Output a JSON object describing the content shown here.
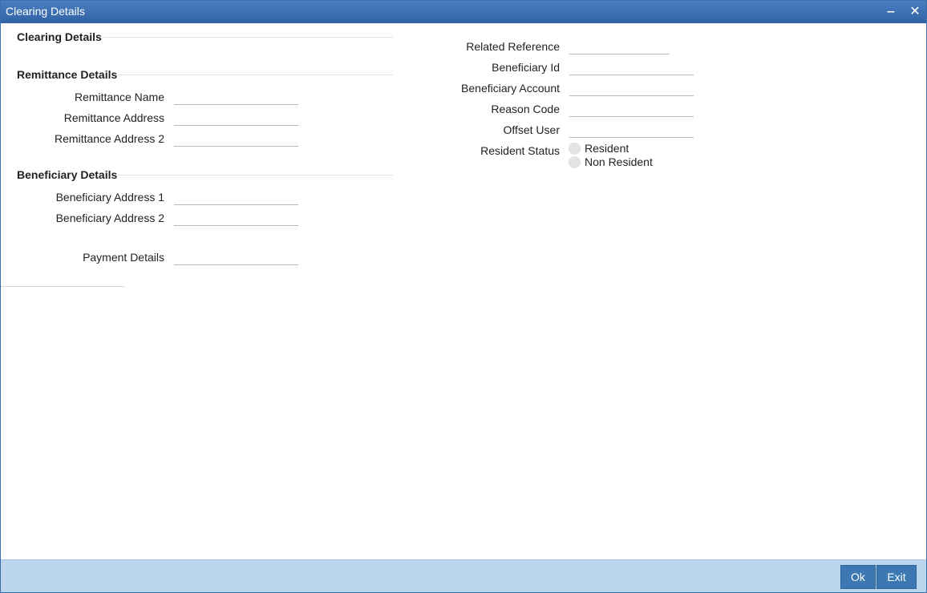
{
  "window": {
    "title": "Clearing Details",
    "minimize_icon": "minimize-icon",
    "close_icon": "close-icon"
  },
  "sections": {
    "clearing": "Clearing Details",
    "remittance": "Remittance Details",
    "beneficiary": "Beneficiary Details"
  },
  "left_fields": {
    "remittance_name": {
      "label": "Remittance Name",
      "value": ""
    },
    "remittance_address": {
      "label": "Remittance Address",
      "value": ""
    },
    "remittance_address_2": {
      "label": "Remittance Address 2",
      "value": ""
    },
    "beneficiary_address_1": {
      "label": "Beneficiary Address 1",
      "value": ""
    },
    "beneficiary_address_2": {
      "label": "Beneficiary Address 2",
      "value": ""
    },
    "payment_details": {
      "label": "Payment Details",
      "value": ""
    }
  },
  "right_fields": {
    "related_reference": {
      "label": "Related Reference",
      "value": ""
    },
    "beneficiary_id": {
      "label": "Beneficiary Id",
      "value": ""
    },
    "beneficiary_account": {
      "label": "Beneficiary Account",
      "value": ""
    },
    "reason_code": {
      "label": "Reason Code",
      "value": ""
    },
    "offset_user": {
      "label": "Offset User",
      "value": ""
    }
  },
  "resident_status": {
    "label": "Resident Status",
    "options": [
      "Resident",
      "Non Resident"
    ],
    "selected": null
  },
  "footer": {
    "ok_label": "Ok",
    "exit_label": "Exit"
  }
}
